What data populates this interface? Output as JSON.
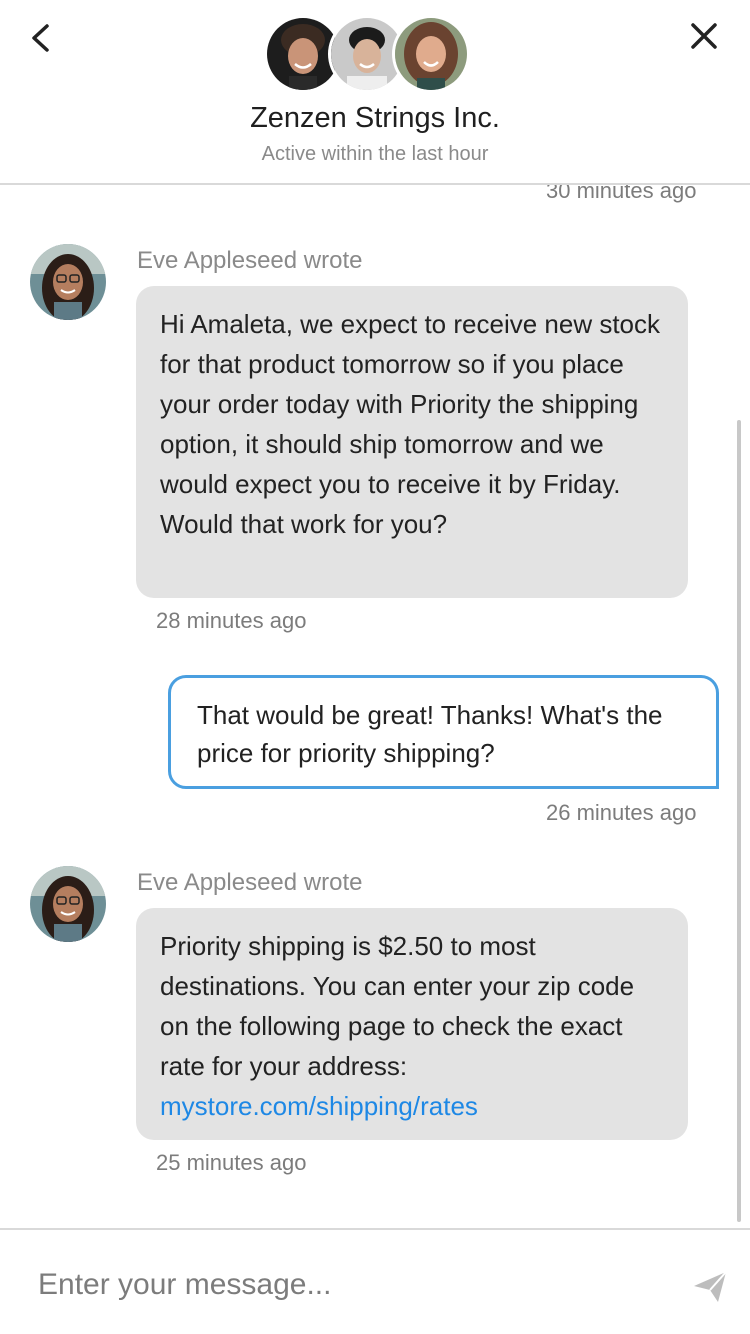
{
  "header": {
    "title": "Zenzen Strings Inc.",
    "subtitle": "Active within the last hour",
    "back_icon": "chevron-left-icon",
    "close_icon": "close-icon"
  },
  "messages": [
    {
      "type": "timestamp",
      "time": "30 minutes ago",
      "align": "right"
    },
    {
      "type": "incoming",
      "author": "Eve Appleseed wrote",
      "text": "Hi Amaleta, we expect to receive new stock for that product tomorrow so if you place your order today with Priority the shipping option, it should ship tomorrow and we would expect you to receive it by Friday. Would that work for you?",
      "time": "28 minutes ago"
    },
    {
      "type": "outgoing",
      "text": "That would be great! Thanks! What's the price for priority shipping?",
      "time": "26 minutes ago"
    },
    {
      "type": "incoming",
      "author": "Eve Appleseed wrote",
      "text": "Priority shipping is $2.50 to most destinations. You can enter your zip code on the following page to check the exact rate for your address:",
      "link": "mystore.com/shipping/rates",
      "time": "25 minutes ago"
    }
  ],
  "composer": {
    "placeholder": "Enter your message...",
    "send_icon": "send-icon"
  },
  "colors": {
    "accent": "#4a9fe0",
    "link": "#1e88e5",
    "incoming_bubble": "#e3e3e3",
    "muted_text": "#8a8a8a"
  }
}
